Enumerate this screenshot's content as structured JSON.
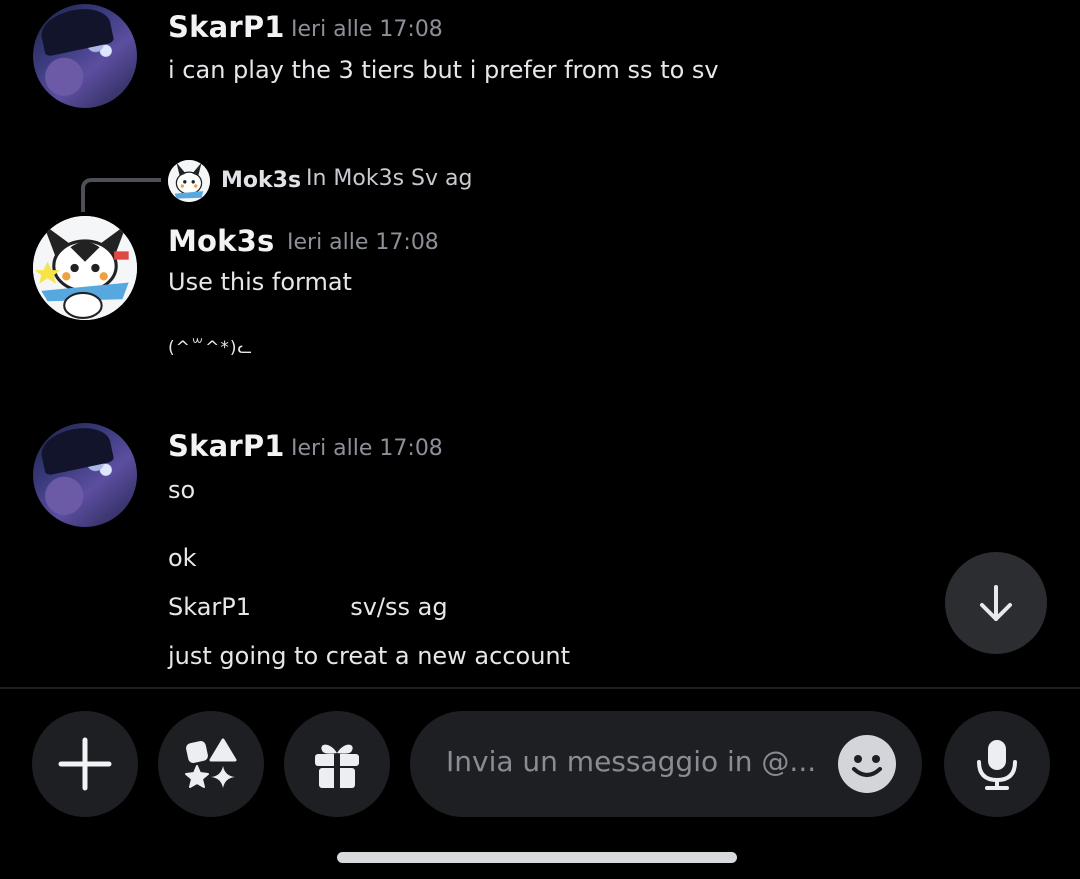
{
  "messages": [
    {
      "username": "SkarP1",
      "timestamp": "Ieri alle 17:08",
      "lines": [
        "i can play the 3 tiers but i prefer from ss to sv"
      ]
    },
    {
      "reply": {
        "username": "Mok3s",
        "text": "In Mok3s Sv ag"
      },
      "username": "Mok3s",
      "timestamp": "Ieri alle 17:08",
      "lines": [
        "Use this format",
        "(^꒳^*)ᓚ"
      ]
    },
    {
      "username": "SkarP1",
      "timestamp": "Ieri alle 17:08",
      "lines": [
        "so",
        "ok",
        "SkarP1             sv/ss ag",
        "just going to creat a new account"
      ]
    }
  ],
  "composer": {
    "placeholder": "Invia un messaggio in @..."
  },
  "icons": {
    "add": "plus-icon",
    "apps": "apps-icon",
    "gift": "gift-icon",
    "emoji": "emoji-icon",
    "voice": "microphone-icon",
    "scroll": "arrow-down-icon"
  },
  "colors": {
    "background": "#000000",
    "button_bg": "#1e1f22",
    "fab_bg": "#2b2d31",
    "timestamp": "#8e9099",
    "placeholder": "#8a8c95"
  }
}
